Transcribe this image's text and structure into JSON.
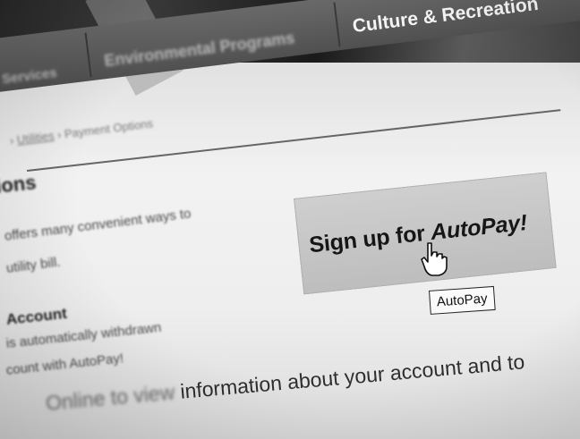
{
  "nav": {
    "items": [
      "Services",
      "Environmental Programs",
      "Culture & Recreation"
    ]
  },
  "breadcrumb": {
    "prev": "Utilities",
    "current": "Payment Options"
  },
  "heading": "ions",
  "intro": {
    "line1": "offers many convenient ways to",
    "line2": "utility bill."
  },
  "account": {
    "title": "Account",
    "line1": "is automatically withdrawn",
    "line2": "count with AutoPay!"
  },
  "autopay_button": {
    "prefix": "Sign up for ",
    "emph": "AutoPay!"
  },
  "tooltip": "AutoPay",
  "bottom": {
    "faded": "Online to view",
    "text": "information about your account and to"
  }
}
